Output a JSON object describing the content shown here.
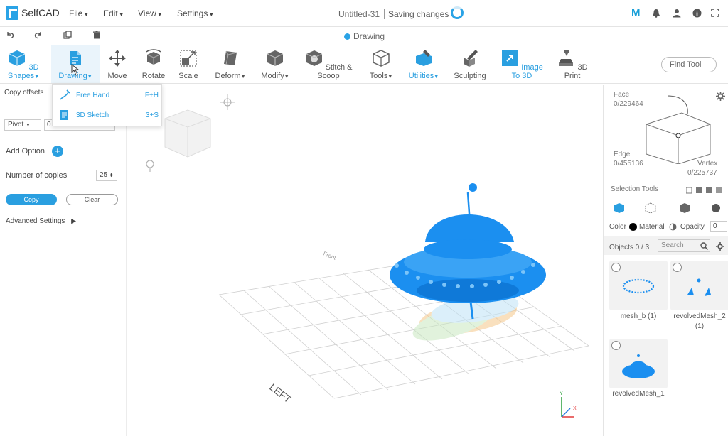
{
  "app": {
    "logo": "SelfCAD",
    "menus": [
      "File",
      "Edit",
      "View",
      "Settings"
    ],
    "doc_title": "Untitled-31",
    "save_status": "Saving changes",
    "user_initial": "M",
    "mode": "Drawing"
  },
  "toolbar": {
    "tools": [
      "3D Shapes",
      "Drawing",
      "Move",
      "Rotate",
      "Scale",
      "Deform",
      "Modify",
      "Stitch & Scoop",
      "Tools",
      "Utilities",
      "Sculpting",
      "Image To 3D",
      "3D Print"
    ],
    "find_tool": "Find Tool"
  },
  "drawing_menu": {
    "items": [
      {
        "label": "Free Hand",
        "shortcut": "F+H"
      },
      {
        "label": "3D Sketch",
        "shortcut": "3+S"
      }
    ]
  },
  "left_panel": {
    "section_title": "Copy offsets",
    "pivot_value": "Pivot",
    "pivot_field": "0",
    "add_option": "Add Option",
    "copies_label": "Number of copies",
    "copies_value": "25",
    "copy_button": "Copy",
    "clear_button": "Clear",
    "advanced": "Advanced Settings"
  },
  "viewport": {
    "axis_label": "LEFT",
    "far_label": "Front"
  },
  "right_panel": {
    "face_label": "Face",
    "face_count": "0/229464",
    "edge_label": "Edge",
    "edge_count": "0/455136",
    "vertex_label": "Vertex",
    "vertex_count": "0/225737",
    "selection_tools": "Selection Tools",
    "color_label": "Color",
    "material_label": "Material",
    "opacity_label": "Opacity",
    "opacity_value": "0",
    "objects_label": "Objects 0 / 3",
    "search_placeholder": "Search",
    "objects": [
      {
        "name": "mesh_b (1)"
      },
      {
        "name": "revolvedMesh_2",
        "suffix": "(1)"
      },
      {
        "name": "revolvedMesh_1"
      }
    ]
  },
  "colors": {
    "accent": "#2a9fe0",
    "ufo": "#1b8ff0"
  }
}
